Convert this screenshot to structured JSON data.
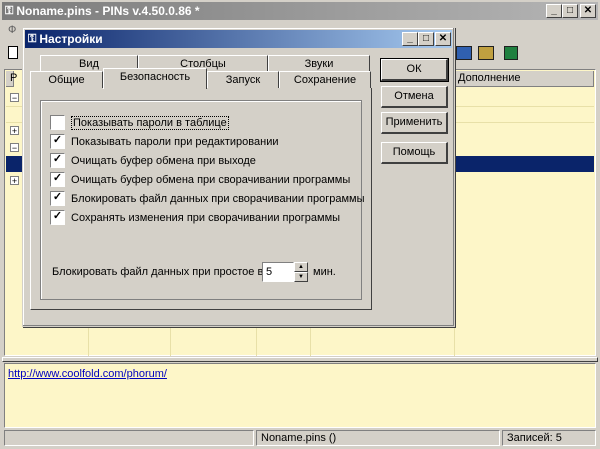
{
  "main_window": {
    "title": "Noname.pins - PINs v.4.50.0.86 *",
    "menu_partial": "Ф",
    "header_first": "Р",
    "header_last": "Дополнение",
    "tree_markers": [
      "−",
      "+",
      "−",
      "+"
    ],
    "link": "http://www.coolfold.com/phorum/",
    "status_file": "Noname.pins ()",
    "status_records": "Записей: 5"
  },
  "dialog": {
    "title": "Настройки",
    "tabs_back": [
      "Вид",
      "Столбцы",
      "Звуки"
    ],
    "tabs_front": [
      "Общие",
      "Безопасность",
      "Запуск",
      "Сохранение"
    ],
    "active_tab": "Безопасность",
    "options": [
      {
        "label": "Показывать пароли в таблице",
        "checked": false
      },
      {
        "label": "Показывать пароли при редактировании",
        "checked": true
      },
      {
        "label": "Очищать буфер обмена при выходе",
        "checked": true
      },
      {
        "label": "Очищать буфер обмена при сворачивании программы",
        "checked": true
      },
      {
        "label": "Блокировать файл данных при сворачивании программы",
        "checked": true
      },
      {
        "label": "Сохранять изменения при сворачивании программы",
        "checked": true
      }
    ],
    "lock_label": "Блокировать файл данных при простое в",
    "lock_value": "5",
    "lock_unit": "мин.",
    "buttons": {
      "ok": "ОК",
      "cancel": "Отмена",
      "apply": "Применить",
      "help": "Помощь"
    },
    "check_glyph": "✓"
  }
}
